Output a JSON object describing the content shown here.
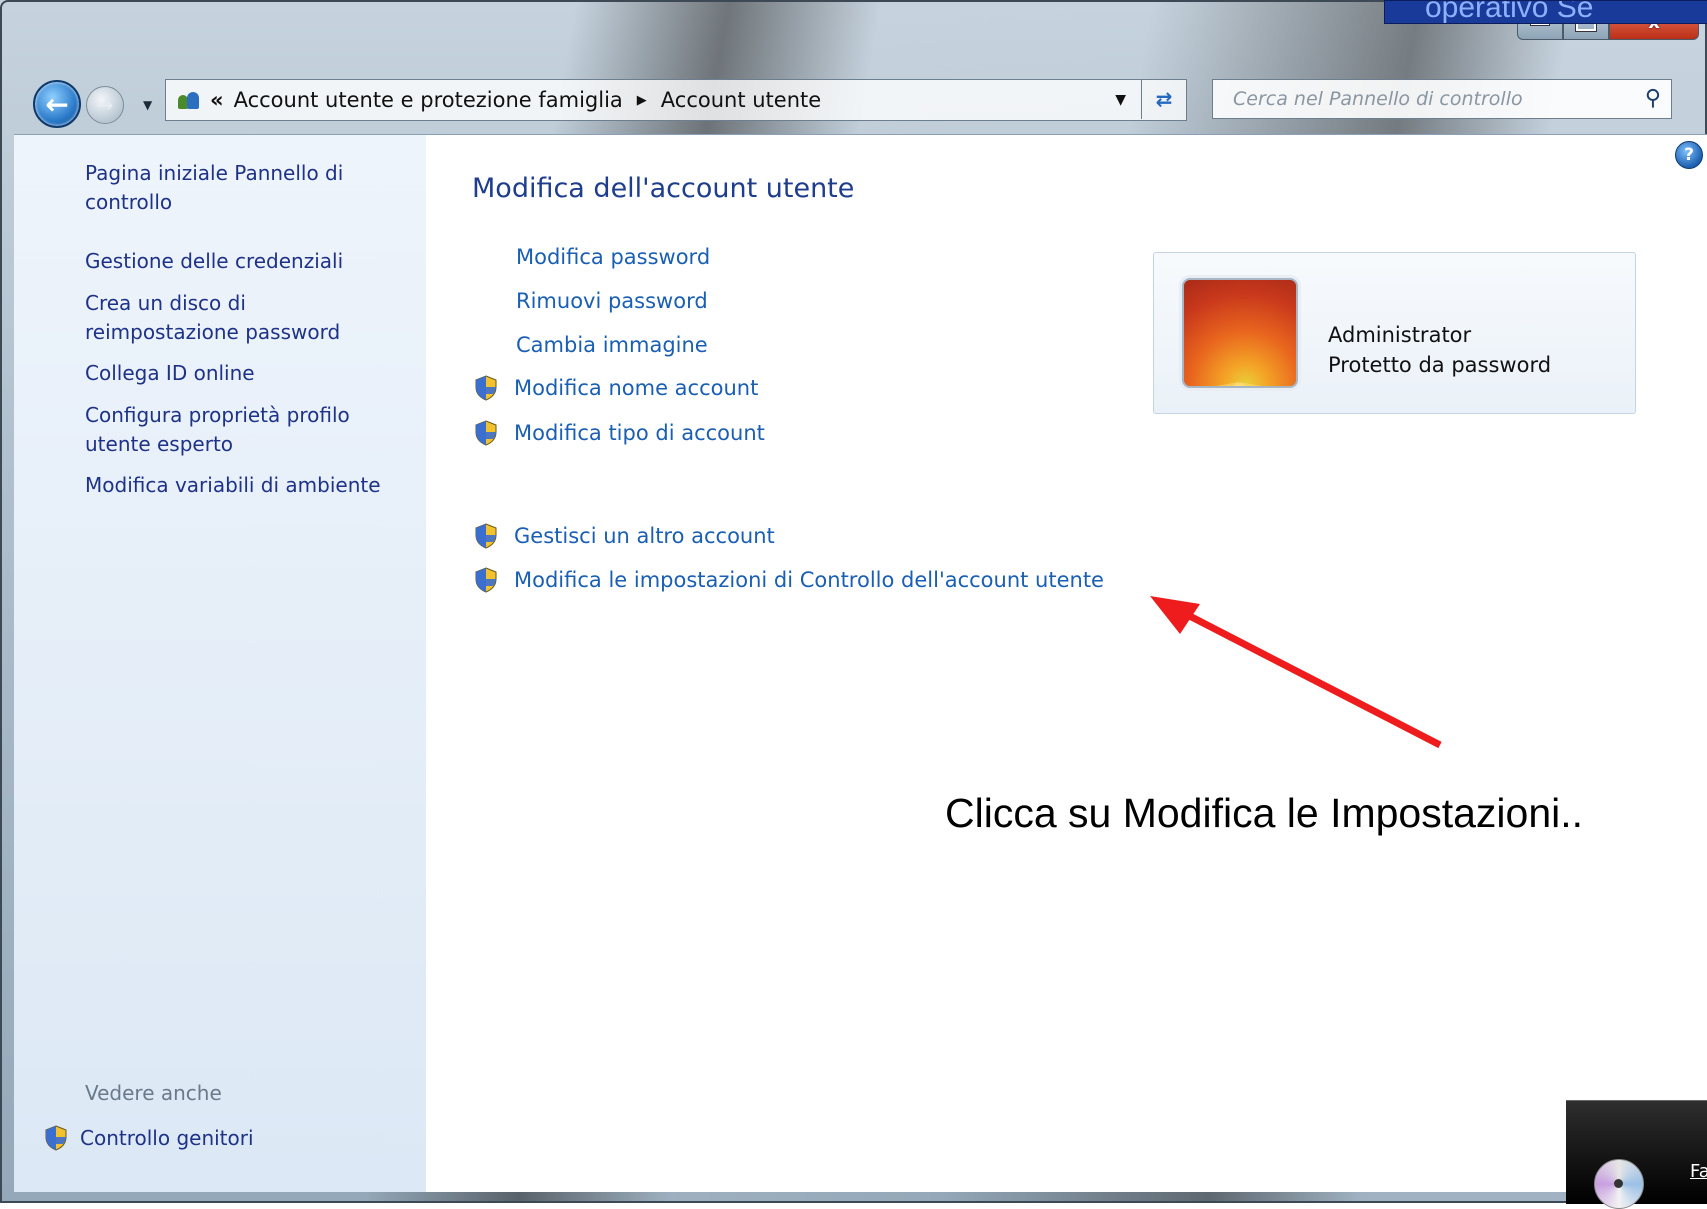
{
  "overlay": {
    "slide_title": "operativo Se"
  },
  "window": {
    "caption": {
      "minimize": "",
      "maximize": "",
      "close": "x"
    }
  },
  "address_bar": {
    "overflow_chevron": "«",
    "crumbs": [
      "Account utente e protezione famiglia",
      "Account utente"
    ],
    "separator": "▶"
  },
  "search": {
    "placeholder": "Cerca nel Pannello di controllo"
  },
  "sidebar": {
    "items": [
      {
        "label": "Pagina iniziale Pannello di controllo"
      },
      {
        "label": "Gestione delle credenziali"
      },
      {
        "label": "Crea un disco di reimpostazione password"
      },
      {
        "label": "Collega ID online"
      },
      {
        "label": "Configura proprietà profilo utente esperto"
      },
      {
        "label": "Modifica variabili di ambiente"
      }
    ],
    "see_also_heading": "Vedere anche",
    "see_also": [
      {
        "label": "Controllo genitori",
        "icon": "uac-shield-icon"
      }
    ]
  },
  "main": {
    "title": "Modifica dell'account utente",
    "tasks": [
      {
        "label": "Modifica password",
        "shield": false
      },
      {
        "label": "Rimuovi password",
        "shield": false
      },
      {
        "label": "Cambia immagine",
        "shield": false
      },
      {
        "label": "Modifica nome account",
        "shield": true
      },
      {
        "label": "Modifica tipo di account",
        "shield": true
      }
    ],
    "more_tasks": [
      {
        "label": "Gestisci un altro account",
        "shield": true
      },
      {
        "label": "Modifica le impostazioni di Controllo dell'account utente",
        "shield": true
      }
    ]
  },
  "user_card": {
    "name": "Administrator",
    "status": "Protetto da password"
  },
  "annotation": {
    "callout": "Clicca su Modifica le Impostazioni..",
    "color": "#ee1c1c"
  },
  "toast": {
    "text": "Fa"
  },
  "colors": {
    "link": "#1a5fb4",
    "heading": "#1e3d8c",
    "sidebar_link": "#1e3287"
  }
}
